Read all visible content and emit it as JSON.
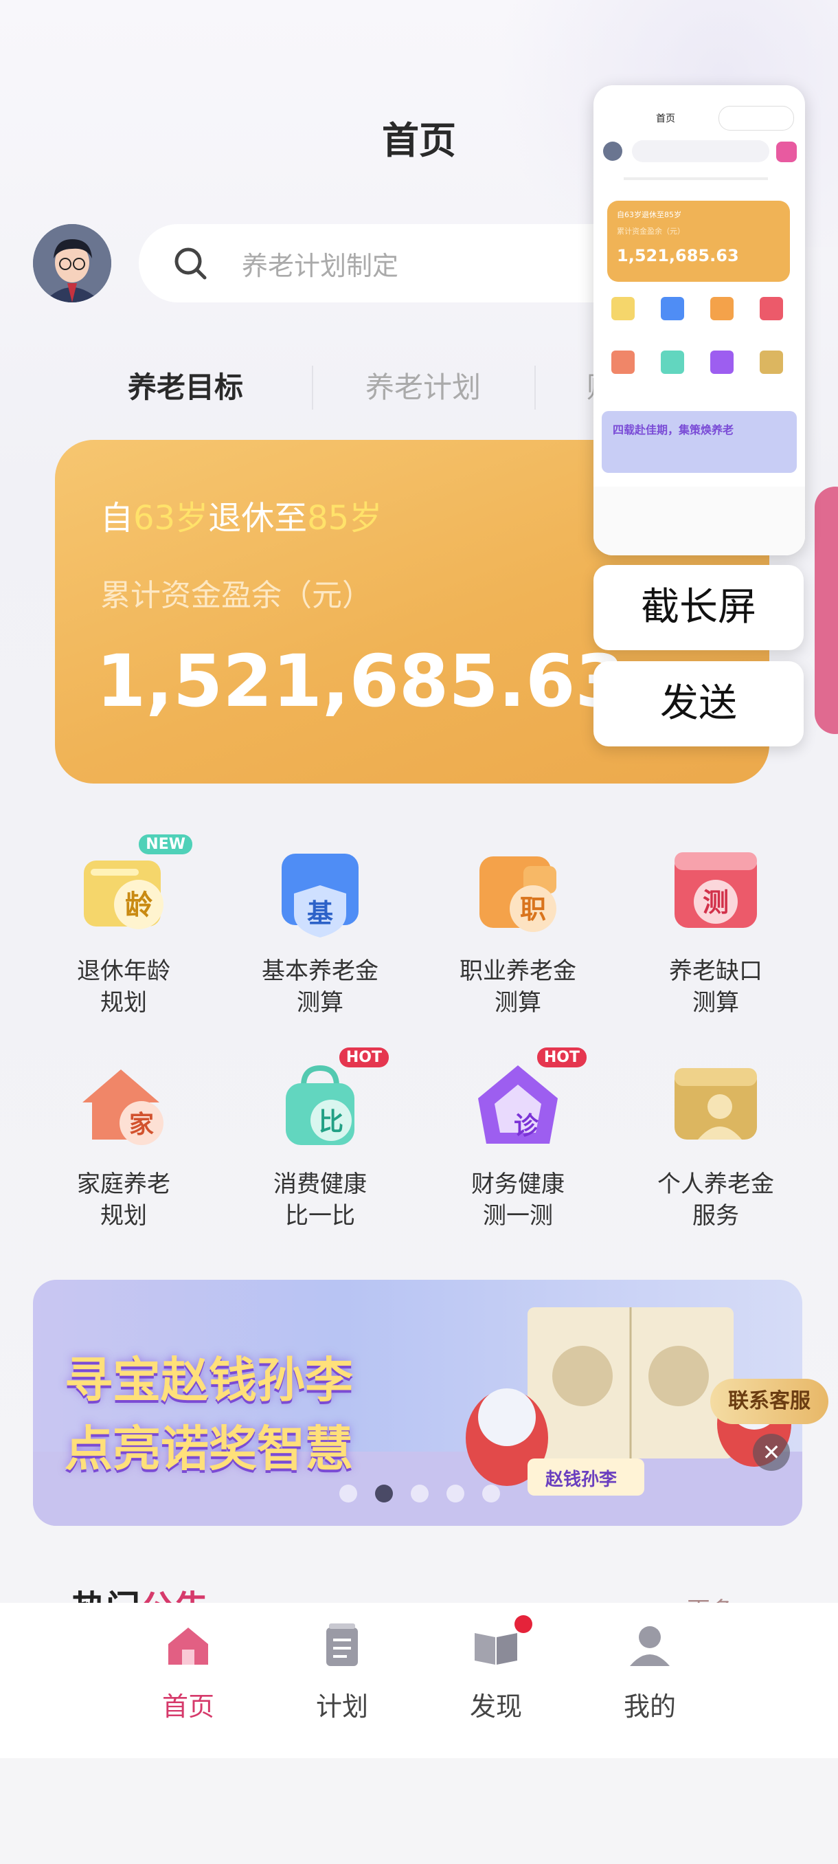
{
  "page": {
    "title": "首页"
  },
  "search": {
    "placeholder": "养老计划制定"
  },
  "tabs": [
    {
      "label": "养老目标"
    },
    {
      "label": "养老计划"
    },
    {
      "label": "财"
    }
  ],
  "summary": {
    "prefix": "自",
    "age_start": "63岁",
    "middle": "退休至",
    "age_end": "85岁",
    "caption": "累计资金盈余（元）",
    "amount": "1,521,685.63"
  },
  "services": [
    {
      "line1": "退休年龄",
      "line2": "规划",
      "icon": "age-icon",
      "glyph": "龄",
      "badge": "NEW"
    },
    {
      "line1": "基本养老金",
      "line2": "测算",
      "icon": "basic-pension-icon",
      "glyph": "基",
      "badge": ""
    },
    {
      "line1": "职业养老金",
      "line2": "测算",
      "icon": "occupational-pension-icon",
      "glyph": "职",
      "badge": ""
    },
    {
      "line1": "养老缺口",
      "line2": "测算",
      "icon": "gap-icon",
      "glyph": "测",
      "badge": ""
    },
    {
      "line1": "家庭养老",
      "line2": "规划",
      "icon": "family-icon",
      "glyph": "家",
      "badge": ""
    },
    {
      "line1": "消费健康",
      "line2": "比一比",
      "icon": "consumption-icon",
      "glyph": "比",
      "badge": "HOT"
    },
    {
      "line1": "财务健康",
      "line2": "测一测",
      "icon": "finance-health-icon",
      "glyph": "诊",
      "badge": "HOT"
    },
    {
      "line1": "个人养老金",
      "line2": "服务",
      "icon": "personal-pension-icon",
      "glyph": "",
      "badge": ""
    }
  ],
  "banner": {
    "line1": "寻宝赵钱孙李",
    "line2": "点亮诺奖智慧",
    "logo": "赵钱孙李",
    "slides": 5,
    "active_slide": 2
  },
  "customer_service": {
    "label": "联系客服",
    "close": "✕"
  },
  "section": {
    "title_a": "热门",
    "title_b": "公告",
    "more": "更多 >"
  },
  "tabbar": [
    {
      "label": "首页",
      "icon": "home-icon",
      "active": true
    },
    {
      "label": "计划",
      "icon": "plan-icon",
      "active": false
    },
    {
      "label": "发现",
      "icon": "discover-icon",
      "active": false,
      "dot": true
    },
    {
      "label": "我的",
      "icon": "profile-icon",
      "active": false
    }
  ],
  "overlay": {
    "thumb_title": "首页",
    "thumb_line1": "自63岁退休至85岁",
    "thumb_line2": "累计资金盈余（元）",
    "thumb_amount": "1,521,685.63",
    "thumb_banner": "四载赴佳期，集策焕养老",
    "long_screenshot_label": "截长屏",
    "send_label": "发送"
  },
  "colors": {
    "accent": "#d63a6b",
    "card": "#f0b356",
    "highlight": "#ffe26a"
  }
}
